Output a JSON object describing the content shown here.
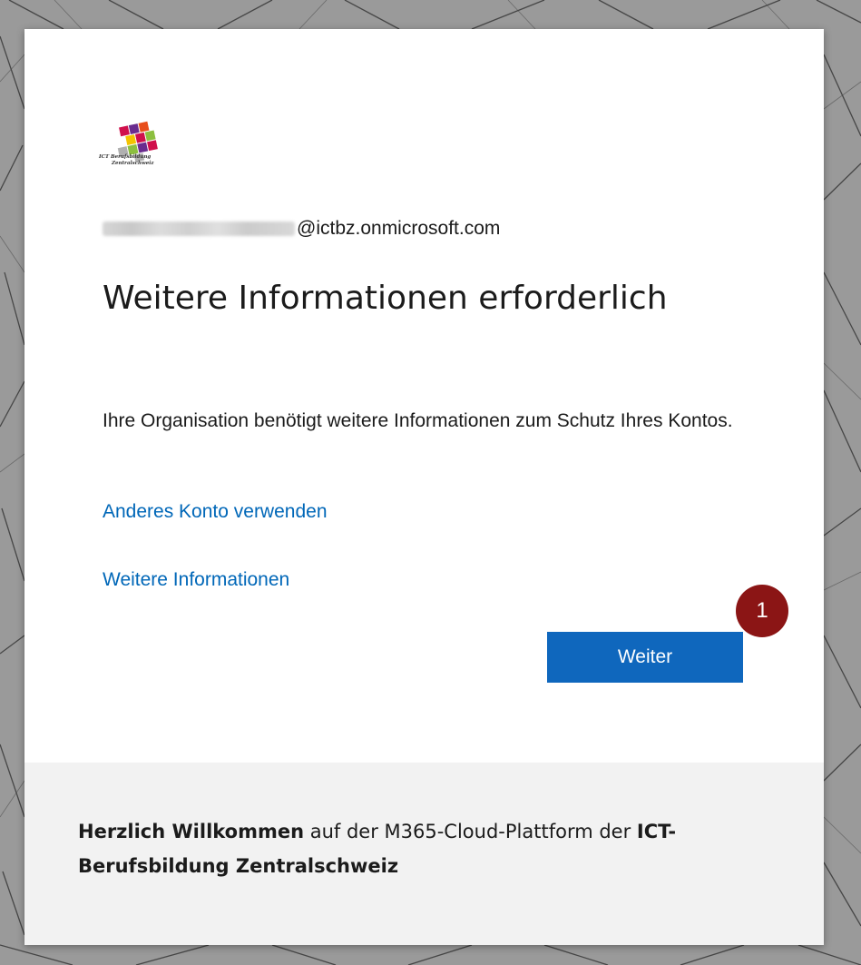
{
  "brand": {
    "logo_alt": "ICT Berufsbildung Zentralschweiz",
    "logo_text_line1": "ICT Berufsbildung",
    "logo_text_line2": "Zentralschweiz",
    "colors": [
      "#d0104c",
      "#6a2c8e",
      "#e84e1b",
      "#f3c300",
      "#8cbf3f",
      "#b0b0b0"
    ]
  },
  "identity": {
    "domain": "@ictbz.onmicrosoft.com"
  },
  "main": {
    "title": "Weitere Informationen erforderlich",
    "description": "Ihre Organisation benötigt weitere Informationen zum Schutz Ihres Kontos.",
    "link_other_account": "Anderes Konto verwenden",
    "link_more_info": "Weitere Informationen",
    "next_button": "Weiter",
    "badge_number": "1"
  },
  "footer": {
    "welcome_bold": "Herzlich Willkommen",
    "welcome_mid": " auf der M365-Cloud-Plattform der ",
    "org_bold": "ICT-Berufsbildung Zentralschweiz"
  },
  "colors": {
    "link": "#0067b8",
    "button": "#0f67bd",
    "badge": "#8b1515",
    "footer_bg": "#f2f2f2"
  }
}
